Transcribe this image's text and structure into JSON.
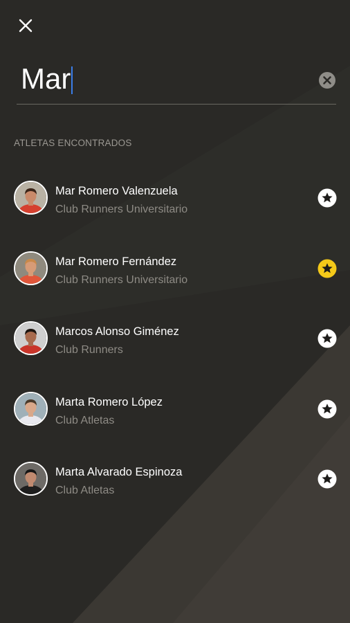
{
  "search": {
    "value": "Mar",
    "placeholder": ""
  },
  "section_label": "ATLETAS ENCONTRADOS",
  "icons": {
    "close": "close-icon",
    "clear": "clear-icon",
    "favorite": "star-icon"
  },
  "colors": {
    "background": "#2b2a27",
    "favorite_active": "#f4c919",
    "favorite_inactive": "#ffffff",
    "cursor": "#3b7de8"
  },
  "athletes": [
    {
      "name": "Mar Romero Valenzuela",
      "club": "Club Runners Universitario",
      "favorite": false
    },
    {
      "name": "Mar Romero Fernández",
      "club": "Club Runners Universitario",
      "favorite": true
    },
    {
      "name": "Marcos Alonso Giménez",
      "club": "Club Runners",
      "favorite": false
    },
    {
      "name": "Marta Romero López",
      "club": "Club Atletas",
      "favorite": false
    },
    {
      "name": "Marta Alvarado Espinoza",
      "club": "Club Atletas",
      "favorite": false
    }
  ]
}
